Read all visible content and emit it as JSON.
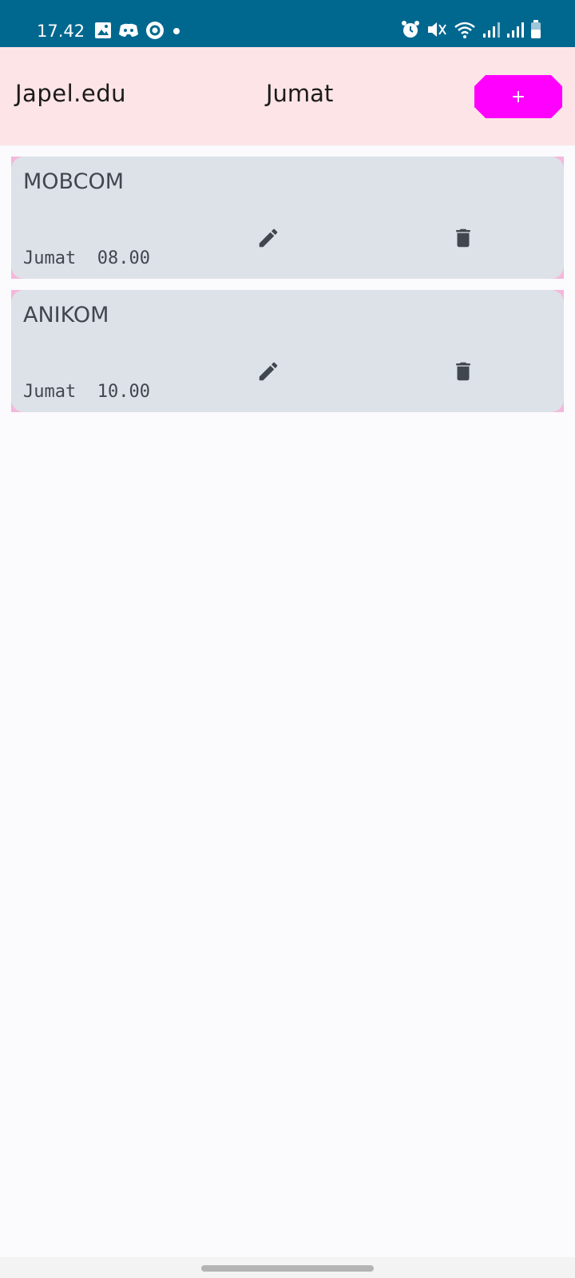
{
  "status_bar": {
    "time": "17.42",
    "left_icons": [
      "gallery-icon",
      "discord-icon",
      "app-circle-icon",
      "dot-icon"
    ],
    "right_icons": [
      "alarm-icon",
      "mute-icon",
      "wifi-icon",
      "signal-icon",
      "signal-icon",
      "battery-icon"
    ]
  },
  "app_bar": {
    "brand": "Japel.edu",
    "title": "Jumat",
    "add_label": "+"
  },
  "schedules": [
    {
      "name": "MOBCOM",
      "time": "Jumat  08.00"
    },
    {
      "name": "ANIKOM",
      "time": "Jumat  10.00"
    }
  ],
  "colors": {
    "status_bar": "#00688f",
    "app_bar": "#fde4e6",
    "add_button": "#ff00ff",
    "card": "#dde1e8",
    "card_border": "#f5b7dc",
    "icon": "#41474e"
  }
}
